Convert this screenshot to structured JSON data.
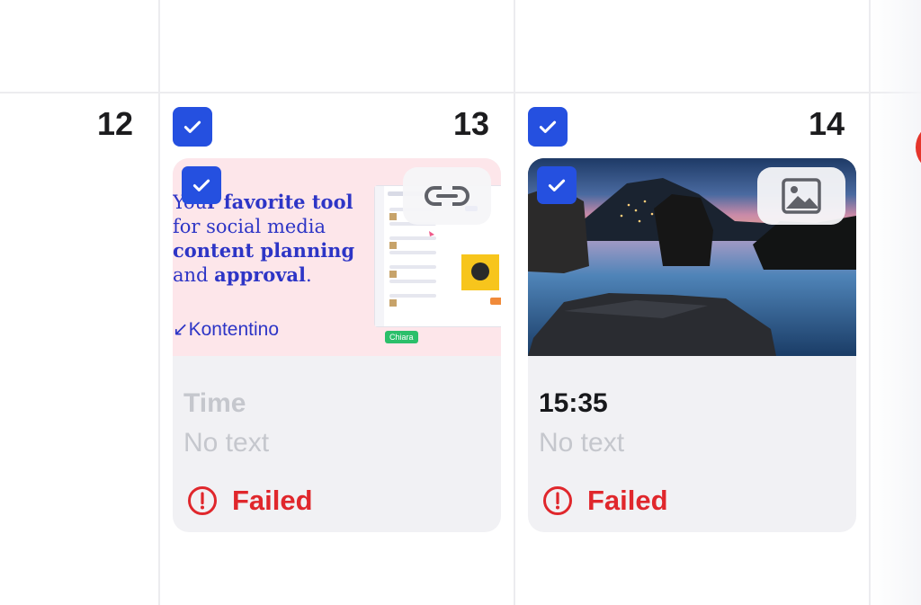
{
  "calendar": {
    "days": [
      {
        "number": "12"
      },
      {
        "number": "13"
      },
      {
        "number": "14"
      }
    ]
  },
  "cards": [
    {
      "type_icon": "link-icon",
      "time": "Time",
      "text": "No text",
      "status": "Failed",
      "status_icon": "alert-circle-icon",
      "preview": {
        "kind": "promo-image",
        "lines": [
          {
            "pre": "You",
            "bold": "r favorite tool",
            "post": ""
          },
          {
            "pre": "for social media",
            "bold": "",
            "post": ""
          },
          {
            "pre": "",
            "bold": "content planning",
            "post": ""
          },
          {
            "pre": "and ",
            "bold": "approval",
            "post": "."
          }
        ],
        "brand": "↙Kontentino",
        "tag": "Chiara"
      }
    },
    {
      "type_icon": "image-icon",
      "time": "15:35",
      "text": "No text",
      "status": "Failed",
      "status_icon": "alert-circle-icon",
      "preview": {
        "kind": "landscape-photo"
      }
    }
  ],
  "colors": {
    "accent": "#2550E0",
    "failed": "#E0272C",
    "card_bg": "#F1F1F4",
    "muted_text": "#C5C7CD"
  }
}
